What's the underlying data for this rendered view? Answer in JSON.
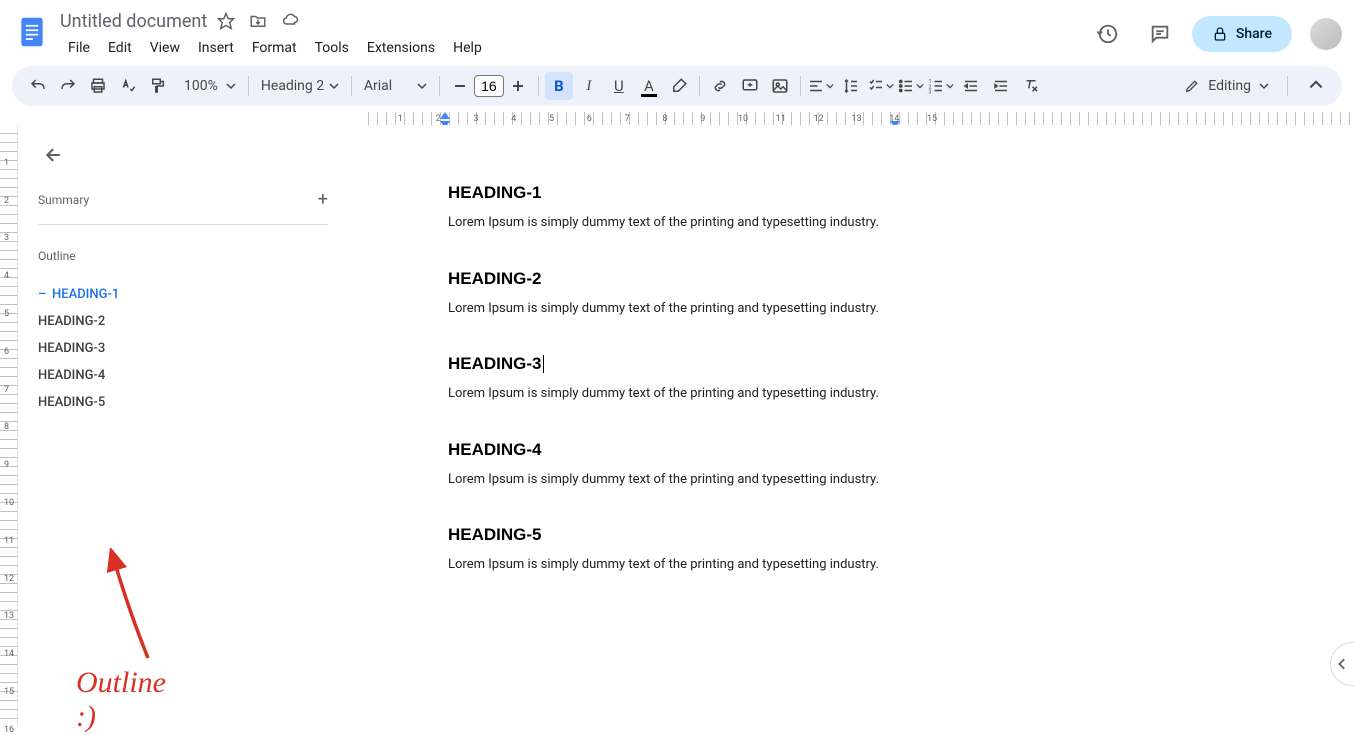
{
  "header": {
    "title": "Untitled document",
    "menus": [
      "File",
      "Edit",
      "View",
      "Insert",
      "Format",
      "Tools",
      "Extensions",
      "Help"
    ],
    "share_label": "Share"
  },
  "toolbar": {
    "zoom": "100%",
    "style": "Heading 2",
    "font": "Arial",
    "font_size": "16",
    "editing_label": "Editing"
  },
  "outline": {
    "summary_label": "Summary",
    "outline_label": "Outline",
    "items": [
      {
        "label": "HEADING-1",
        "active": true
      },
      {
        "label": "HEADING-2",
        "active": false
      },
      {
        "label": "HEADING-3",
        "active": false
      },
      {
        "label": "HEADING-4",
        "active": false
      },
      {
        "label": "HEADING-5",
        "active": false
      }
    ]
  },
  "document": {
    "sections": [
      {
        "heading": "HEADING-1",
        "body": "Lorem Ipsum is simply dummy text of the printing and typesetting industry."
      },
      {
        "heading": "HEADING-2",
        "body": "Lorem Ipsum is simply dummy text of the printing and typesetting industry."
      },
      {
        "heading": "HEADING-3",
        "body": "Lorem Ipsum is simply dummy text of the printing and typesetting industry."
      },
      {
        "heading": "HEADING-4",
        "body": "Lorem Ipsum is simply dummy text of the printing and typesetting industry."
      },
      {
        "heading": "HEADING-5",
        "body": "Lorem Ipsum is simply dummy text of the printing and typesetting industry."
      }
    ],
    "cursor_section": 2
  },
  "annotation": {
    "text": "Outline :)"
  },
  "ruler": {
    "h_numbers": [
      1,
      2,
      3,
      4,
      5,
      6,
      7,
      8,
      9,
      10,
      11,
      12,
      13,
      14,
      15
    ],
    "v_numbers": [
      1,
      2,
      3,
      4,
      5,
      6,
      7,
      8,
      9,
      10,
      11,
      12,
      13,
      14,
      15,
      16
    ]
  }
}
